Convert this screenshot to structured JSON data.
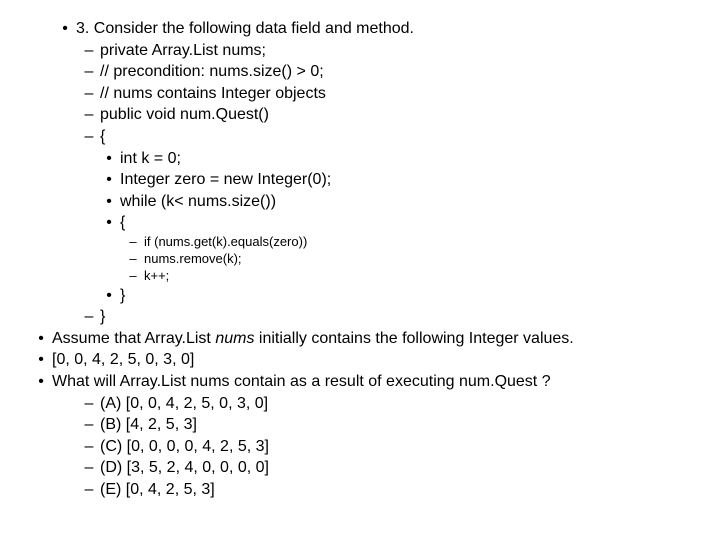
{
  "q": {
    "l1": "3. Consider the following data field and method.",
    "l2": "private Array.List nums;",
    "l3": "// precondition: nums.size() > 0;",
    "l4": "// nums contains Integer objects",
    "l5": "public void num.Quest()",
    "l6": "{",
    "l7": "int k = 0;",
    "l8": "Integer zero = new Integer(0);",
    "l9": "while (k< nums.size())",
    "l10": "{",
    "l11": "if (nums.get(k).equals(zero))",
    "l12": "nums.remove(k);",
    "l13": "k++;",
    "l14": "}",
    "l15": "}",
    "assume_a": "Assume that Array.List ",
    "assume_b": "nums",
    "assume_c": " initially contains the following Integer values.",
    "values": "[0, 0, 4, 2, 5, 0, 3, 0]",
    "ask": "What will Array.List nums contain as a result of executing num.Quest ?",
    "optA": "(A) [0, 0, 4, 2, 5, 0, 3, 0]",
    "optB": "(B) [4, 2, 5, 3]",
    "optC": "(C) [0, 0, 0, 0, 4, 2, 5, 3]",
    "optD": "(D) [3, 5, 2, 4, 0, 0, 0, 0]",
    "optE": "(E) [0, 4, 2, 5, 3]"
  }
}
